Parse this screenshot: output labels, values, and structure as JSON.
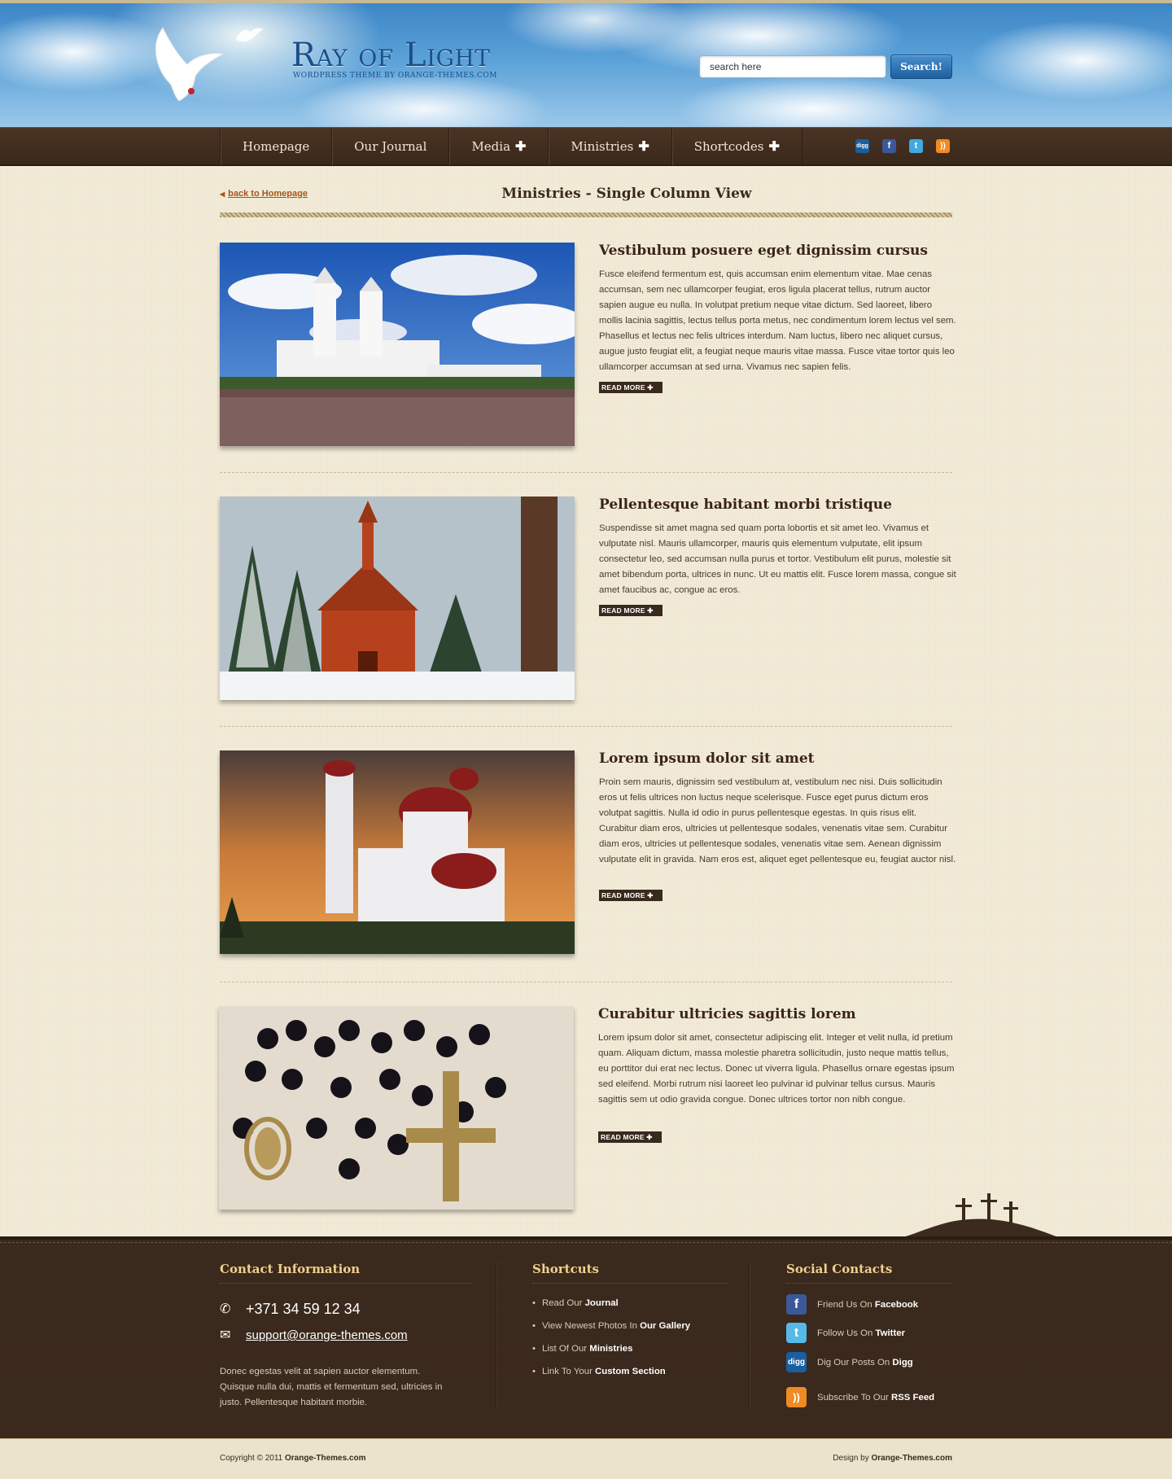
{
  "header": {
    "logo_title": "Ray of Light",
    "logo_subtitle": "WORDPRESS THEME BY ORANGE-THEMES.COM",
    "search": {
      "value": "search here",
      "button": "Search!"
    }
  },
  "nav": {
    "items": [
      {
        "label": "Homepage",
        "has_submenu": false
      },
      {
        "label": "Our Journal",
        "has_submenu": false
      },
      {
        "label": "Media",
        "has_submenu": true
      },
      {
        "label": "Ministries",
        "has_submenu": true
      },
      {
        "label": "Shortcodes",
        "has_submenu": true
      }
    ],
    "plus": "✚",
    "social_icons": [
      {
        "name": "digg-icon",
        "glyph": "digg"
      },
      {
        "name": "facebook-icon",
        "glyph": "f"
      },
      {
        "name": "twitter-icon",
        "glyph": "t"
      },
      {
        "name": "rss-icon",
        "glyph": "))"
      }
    ]
  },
  "page": {
    "back_link": "back to Homepage",
    "title": "Ministries - Single Column View"
  },
  "posts": [
    {
      "title": "Vestibulum posuere eget dignissim cursus",
      "body": "Fusce eleifend fermentum est, quis accumsan enim elementum vitae. Mae cenas accumsan, sem nec ullamcorper feugiat, eros ligula placerat tellus, rutrum auctor sapien augue eu nulla. In volutpat pretium neque vitae dictum. Sed laoreet, libero mollis lacinia sagittis, lectus tellus porta metus, nec condimentum lorem lectus vel sem. Phasellus et lectus nec felis ultrices interdum. Nam luctus, libero nec aliquet cursus, augue justo feugiat elit, a feugiat neque mauris vitae massa. Fusce vitae tortor quis leo ullamcorper accumsan at sed urna. Vivamus nec sapien felis.",
      "read_more": "READ MORE ✚",
      "image": "white-cathedral-crowd-photo"
    },
    {
      "title": "Pellentesque habitant morbi tristique",
      "body": "Suspendisse sit amet magna sed quam porta lobortis et sit amet leo. Vivamus et vulputate nisl. Mauris ullamcorper, mauris quis elementum vulputate, elit ipsum consectetur leo, sed accumsan nulla purus et tortor. Vestibulum elit purus, molestie sit amet bibendum porta, ultrices in nunc. Ut eu mattis elit. Fusce lorem massa, congue sit amet faucibus ac, congue ac eros.",
      "read_more": "READ MORE ✚",
      "image": "red-chapel-snow-photo"
    },
    {
      "title": "Lorem ipsum dolor sit amet",
      "body": "Proin sem mauris, dignissim sed vestibulum at, vestibulum nec nisi. Duis sollicitudin eros ut felis ultrices non luctus neque scelerisque. Fusce eget purus dictum eros volutpat sagittis. Nulla id odio in purus pellentesque egestas. In quis risus elit. Curabitur diam eros, ultricies ut pellentesque sodales, venenatis vitae sem. Curabitur diam eros, ultricies ut pellentesque sodales, venenatis vitae sem. Aenean dignissim vulputate elit in gravida. Nam eros est, aliquet eget pellentesque eu, feugiat auctor nisl.",
      "read_more": "READ MORE ✚",
      "image": "orthodox-church-sunset-photo"
    },
    {
      "title": "Curabitur ultricies sagittis lorem",
      "body": "Lorem ipsum dolor sit amet, consectetur adipiscing elit. Integer et velit nulla, id pretium quam. Aliquam dictum, massa molestie pharetra sollicitudin, justo neque mattis tellus, eu porttitor dui erat nec lectus. Donec ut viverra ligula. Phasellus ornare egestas ipsum sed eleifend. Morbi rutrum nisi laoreet leo pulvinar id pulvinar tellus cursus. Mauris sagittis sem ut odio gravida congue. Donec ultrices tortor non nibh congue.",
      "read_more": "READ MORE ✚",
      "image": "rosary-beads-photo"
    }
  ],
  "footer": {
    "contact": {
      "title": "Contact Information",
      "phone": "+371 34 59 12 34",
      "email": "support@orange-themes.com",
      "about": "Donec egestas velit at sapien auctor elementum. Quisque nulla dui, mattis et fermentum sed, ultricies in justo. Pellentesque habitant morbie."
    },
    "shortcuts": {
      "title": "Shortcuts",
      "items": [
        {
          "text": "Read Our ",
          "bold": "Journal"
        },
        {
          "text": "View Newest Photos In ",
          "bold": "Our Gallery"
        },
        {
          "text": "List Of Our ",
          "bold": "Ministries"
        },
        {
          "text": "Link To Your ",
          "bold": "Custom Section"
        }
      ]
    },
    "social": {
      "title": "Social Contacts",
      "items": [
        {
          "text": "Friend Us On ",
          "bold": "Facebook",
          "icon": "facebook-icon",
          "glyph": "f"
        },
        {
          "text": "Follow Us On ",
          "bold": "Twitter",
          "icon": "twitter-icon",
          "glyph": "t"
        },
        {
          "text": "Dig Our Posts On ",
          "bold": "Digg",
          "icon": "digg-icon",
          "glyph": "digg"
        },
        {
          "text": "Subscribe To Our  ",
          "bold": "RSS Feed",
          "icon": "rss-icon",
          "glyph": "))"
        }
      ]
    }
  },
  "bottom": {
    "copyright_prefix": "Copyright © 2011 ",
    "copyright_bold": "Orange-Themes.com",
    "design_prefix": "Design by ",
    "design_bold": "Orange-Themes.com"
  },
  "colors": {
    "nav_bg": "#3a281b",
    "accent_link": "#a4561b",
    "footer_title": "#f0cf8f",
    "page_bg": "#f3ecd9"
  }
}
